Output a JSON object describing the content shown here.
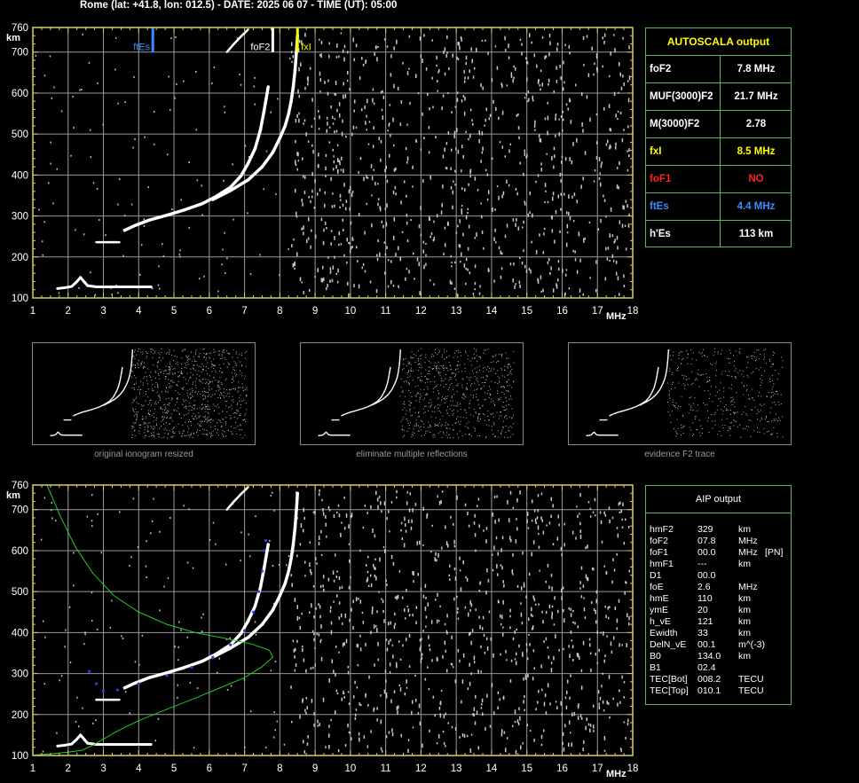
{
  "header": "Rome (lat: +41.8, lon: 012.5) - DATE: 2025 06 07 - TIME (UT): 05:00",
  "autoscala": {
    "title": "AUTOSCALA output",
    "rows": [
      {
        "label": "foF2",
        "value": "7.8 MHz",
        "label_color": "#ffffff",
        "value_color": "#ffffff"
      },
      {
        "label": "MUF(3000)F2",
        "value": "21.7 MHz",
        "label_color": "#ffffff",
        "value_color": "#ffffff"
      },
      {
        "label": "M(3000)F2",
        "value": "2.78",
        "label_color": "#ffffff",
        "value_color": "#ffffff"
      },
      {
        "label": "fxI",
        "value": "8.5 MHz",
        "label_color": "#ffff00",
        "value_color": "#ffff00"
      },
      {
        "label": "foF1",
        "value": "NO",
        "label_color": "#ff2020",
        "value_color": "#ff2020"
      },
      {
        "label": "ftEs",
        "value": "4.4 MHz",
        "label_color": "#3a8cff",
        "value_color": "#3a8cff"
      },
      {
        "label": "h'Es",
        "value": "113     km",
        "label_color": "#ffffff",
        "value_color": "#ffffff"
      }
    ]
  },
  "aip": {
    "title": "AIP output",
    "rows": [
      {
        "name": "hmF2",
        "value": "329",
        "unit": "km",
        "extra": ""
      },
      {
        "name": "foF2",
        "value": "07.8",
        "unit": "MHz",
        "extra": ""
      },
      {
        "name": "foF1",
        "value": "00.0",
        "unit": "MHz",
        "extra": "[PN]"
      },
      {
        "name": "hmF1",
        "value": "---",
        "unit": "km",
        "extra": ""
      },
      {
        "name": "D1",
        "value": "00.0",
        "unit": "",
        "extra": ""
      },
      {
        "name": "foE",
        "value": "2.6",
        "unit": "MHz",
        "extra": ""
      },
      {
        "name": "hmE",
        "value": "110",
        "unit": "km",
        "extra": ""
      },
      {
        "name": "ymE",
        "value": "20",
        "unit": "km",
        "extra": ""
      },
      {
        "name": "h_vE",
        "value": "121",
        "unit": "km",
        "extra": ""
      },
      {
        "name": "Ewidth",
        "value": "33",
        "unit": "km",
        "extra": ""
      },
      {
        "name": "DelN_vE",
        "value": "00.1",
        "unit": "m^(-3)",
        "extra": ""
      },
      {
        "name": "B0",
        "value": "134.0",
        "unit": "km",
        "extra": ""
      },
      {
        "name": "B1",
        "value": "02.4",
        "unit": "",
        "extra": ""
      },
      {
        "name": "TEC[Bot]",
        "value": "008.2",
        "unit": "TECU",
        "extra": ""
      },
      {
        "name": "TEC[Top]",
        "value": "010.1",
        "unit": "TECU",
        "extra": ""
      }
    ]
  },
  "thumbnails": [
    {
      "caption": "original ionogram resized"
    },
    {
      "caption": "eliminate multiple reflections"
    },
    {
      "caption": "evidence F2 trace"
    }
  ],
  "chart_data": [
    {
      "type": "scatter",
      "title": "",
      "xlabel": "MHz",
      "ylabel": "km",
      "xlim": [
        1,
        18
      ],
      "ylim": [
        100,
        760
      ],
      "x_ticks": [
        "1",
        "2",
        "3",
        "4",
        "5",
        "6",
        "7",
        "8",
        "9",
        "10",
        "11",
        "12",
        "13",
        "14",
        "15",
        "16",
        "17",
        "18"
      ],
      "y_ticks": [
        "100",
        "200",
        "300",
        "400",
        "500",
        "600",
        "700",
        "760"
      ],
      "grid": true,
      "colors": {
        "axis": "#d8d060",
        "grid": "#9a9a9a",
        "trace": "#ffffff",
        "ftEs": "#3a8cff",
        "foF2": "#ffffff",
        "fxI": "#ffff00"
      },
      "markers": [
        {
          "name": "ftEs",
          "x": 4.4
        },
        {
          "name": "foF2",
          "x": 7.8
        },
        {
          "name": "fxI",
          "x": 8.5
        }
      ],
      "traces": {
        "es_layer": [
          [
            1.7,
            123
          ],
          [
            1.9,
            125
          ],
          [
            2.1,
            128
          ],
          [
            2.25,
            140
          ],
          [
            2.35,
            150
          ],
          [
            2.45,
            140
          ],
          [
            2.55,
            130
          ],
          [
            2.8,
            127
          ],
          [
            3.2,
            127
          ],
          [
            3.6,
            127
          ],
          [
            4.0,
            127
          ],
          [
            4.35,
            127
          ]
        ],
        "f2_o": [
          [
            3.6,
            265
          ],
          [
            3.9,
            277
          ],
          [
            4.3,
            290
          ],
          [
            4.8,
            302
          ],
          [
            5.3,
            315
          ],
          [
            5.8,
            330
          ],
          [
            6.2,
            348
          ],
          [
            6.6,
            370
          ],
          [
            6.9,
            398
          ],
          [
            7.1,
            428
          ],
          [
            7.3,
            465
          ],
          [
            7.45,
            510
          ],
          [
            7.55,
            555
          ],
          [
            7.62,
            590
          ],
          [
            7.67,
            615
          ]
        ],
        "f2_x": [
          [
            6.1,
            340
          ],
          [
            6.6,
            362
          ],
          [
            7.1,
            388
          ],
          [
            7.5,
            420
          ],
          [
            7.8,
            455
          ],
          [
            8.0,
            490
          ],
          [
            8.15,
            520
          ],
          [
            8.25,
            550
          ],
          [
            8.32,
            580
          ],
          [
            8.38,
            615
          ],
          [
            8.43,
            655
          ],
          [
            8.47,
            700
          ],
          [
            8.5,
            740
          ]
        ],
        "extra_low": [
          [
            2.8,
            236
          ],
          [
            2.9,
            236
          ],
          [
            3.0,
            236
          ],
          [
            3.1,
            236
          ],
          [
            3.2,
            236
          ],
          [
            3.3,
            236
          ],
          [
            3.45,
            236
          ]
        ],
        "top_streak": [
          [
            6.5,
            700
          ],
          [
            6.7,
            720
          ],
          [
            6.9,
            738
          ],
          [
            7.1,
            755
          ]
        ]
      }
    },
    {
      "type": "scatter",
      "title": "",
      "xlabel": "MHz",
      "ylabel": "km",
      "xlim": [
        1,
        18
      ],
      "ylim": [
        100,
        760
      ],
      "x_ticks": [
        "1",
        "2",
        "3",
        "4",
        "5",
        "6",
        "7",
        "8",
        "9",
        "10",
        "11",
        "12",
        "13",
        "14",
        "15",
        "16",
        "17",
        "18"
      ],
      "y_ticks": [
        "100",
        "200",
        "300",
        "400",
        "500",
        "600",
        "700",
        "760"
      ],
      "grid": true,
      "colors": {
        "axis": "#d8d060",
        "grid": "#9a9a9a",
        "trace": "#ffffff",
        "profile": "#22cc22",
        "fit": "#2040ff"
      },
      "traces": {
        "es_layer": [
          [
            1.7,
            123
          ],
          [
            1.9,
            125
          ],
          [
            2.1,
            128
          ],
          [
            2.25,
            140
          ],
          [
            2.35,
            150
          ],
          [
            2.45,
            140
          ],
          [
            2.55,
            130
          ],
          [
            2.8,
            127
          ],
          [
            3.2,
            127
          ],
          [
            3.6,
            127
          ],
          [
            4.0,
            127
          ],
          [
            4.35,
            127
          ]
        ],
        "f2_o": [
          [
            3.6,
            265
          ],
          [
            3.9,
            277
          ],
          [
            4.3,
            290
          ],
          [
            4.8,
            302
          ],
          [
            5.3,
            315
          ],
          [
            5.8,
            330
          ],
          [
            6.2,
            348
          ],
          [
            6.6,
            370
          ],
          [
            6.9,
            398
          ],
          [
            7.1,
            428
          ],
          [
            7.3,
            465
          ],
          [
            7.45,
            510
          ],
          [
            7.55,
            555
          ],
          [
            7.62,
            590
          ],
          [
            7.67,
            615
          ]
        ],
        "f2_x": [
          [
            6.1,
            340
          ],
          [
            6.6,
            362
          ],
          [
            7.1,
            388
          ],
          [
            7.5,
            420
          ],
          [
            7.8,
            455
          ],
          [
            8.0,
            490
          ],
          [
            8.15,
            520
          ],
          [
            8.25,
            550
          ],
          [
            8.32,
            580
          ],
          [
            8.38,
            615
          ],
          [
            8.43,
            655
          ],
          [
            8.47,
            700
          ],
          [
            8.5,
            740
          ]
        ],
        "extra_low": [
          [
            2.8,
            236
          ],
          [
            2.9,
            236
          ],
          [
            3.0,
            236
          ],
          [
            3.1,
            236
          ],
          [
            3.2,
            236
          ],
          [
            3.3,
            236
          ],
          [
            3.45,
            236
          ]
        ],
        "top_streak": [
          [
            6.5,
            700
          ],
          [
            6.7,
            720
          ],
          [
            6.9,
            738
          ],
          [
            7.1,
            755
          ]
        ]
      },
      "profile": [
        [
          1.0,
          101
        ],
        [
          1.5,
          104
        ],
        [
          2.0,
          108
        ],
        [
          2.4,
          113
        ],
        [
          2.7,
          125
        ],
        [
          3.0,
          140
        ],
        [
          3.4,
          160
        ],
        [
          4.0,
          185
        ],
        [
          4.8,
          213
        ],
        [
          5.6,
          240
        ],
        [
          6.3,
          265
        ],
        [
          7.0,
          290
        ],
        [
          7.5,
          317
        ],
        [
          7.8,
          340
        ],
        [
          7.7,
          357
        ],
        [
          7.2,
          372
        ],
        [
          6.5,
          385
        ],
        [
          5.6,
          400
        ],
        [
          4.8,
          420
        ],
        [
          4.0,
          450
        ],
        [
          3.3,
          490
        ],
        [
          2.7,
          545
        ],
        [
          2.2,
          610
        ],
        [
          1.8,
          680
        ],
        [
          1.5,
          740
        ],
        [
          1.4,
          760
        ]
      ],
      "fit": [
        [
          2.6,
          305
        ],
        [
          2.8,
          275
        ],
        [
          3.0,
          258
        ],
        [
          3.4,
          260
        ],
        [
          4.0,
          275
        ],
        [
          4.8,
          295
        ],
        [
          5.5,
          315
        ],
        [
          6.1,
          340
        ],
        [
          6.6,
          370
        ],
        [
          7.0,
          405
        ],
        [
          7.25,
          450
        ],
        [
          7.4,
          500
        ],
        [
          7.5,
          550
        ],
        [
          7.55,
          600
        ],
        [
          7.6,
          625
        ]
      ]
    }
  ]
}
